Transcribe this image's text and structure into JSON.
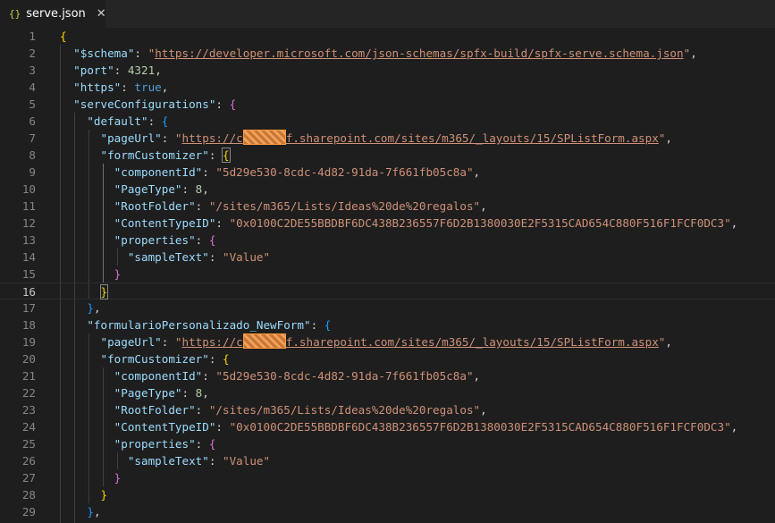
{
  "tab": {
    "icon": "{}",
    "name": "serve.json",
    "close": "✕"
  },
  "lines": [
    {
      "n": "1",
      "html": "<span class='br1'>{</span>"
    },
    {
      "n": "2",
      "html": "  <span class='k'>\"$schema\"</span><span class='p'>: </span><span class='s'>\"<span class='url'>https://developer.microsoft.com/json-schemas/spfx-build/spfx-serve.schema.json</span>\"</span><span class='p'>,</span>"
    },
    {
      "n": "3",
      "html": "  <span class='k'>\"port\"</span><span class='p'>: </span><span class='n'>4321</span><span class='p'>,</span>"
    },
    {
      "n": "4",
      "html": "  <span class='k'>\"https\"</span><span class='p'>: </span><span class='b'>true</span><span class='p'>,</span>"
    },
    {
      "n": "5",
      "html": "  <span class='k'>\"serveConfigurations\"</span><span class='p'>: </span><span class='br2'>{</span>"
    },
    {
      "n": "6",
      "html": "    <span class='k'>\"default\"</span><span class='p'>: </span><span class='br3'>{</span>"
    },
    {
      "n": "7",
      "html": "      <span class='k'>\"pageUrl\"</span><span class='p'>: </span><span class='s'>\"<span class='url'>https://c<span class='redact'></span>f.sharepoint.com/sites/m365/_layouts/15/SPListForm.aspx</span>\"</span><span class='p'>,</span>"
    },
    {
      "n": "8",
      "html": "      <span class='k'>\"formCustomizer\"</span><span class='p'>: </span><span class='br1 bracket-box'>{</span>"
    },
    {
      "n": "9",
      "html": "        <span class='k'>\"componentId\"</span><span class='p'>: </span><span class='s'>\"5d29e530-8cdc-4d82-91da-7f661fb05c8a\"</span><span class='p'>,</span>"
    },
    {
      "n": "10",
      "html": "        <span class='k'>\"PageType\"</span><span class='p'>: </span><span class='n'>8</span><span class='p'>,</span>"
    },
    {
      "n": "11",
      "html": "        <span class='k'>\"RootFolder\"</span><span class='p'>: </span><span class='s'>\"/sites/m365/Lists/Ideas%20de%20regalos\"</span><span class='p'>,</span>"
    },
    {
      "n": "12",
      "html": "        <span class='k'>\"ContentTypeID\"</span><span class='p'>: </span><span class='s'>\"0x0100C2DE55BBDBF6DC438B236557F6D2B1380030E2F5315CAD654C880F516F1FCF0DC3\"</span><span class='p'>,</span>"
    },
    {
      "n": "13",
      "html": "        <span class='k'>\"properties\"</span><span class='p'>: </span><span class='br2'>{</span>"
    },
    {
      "n": "14",
      "html": "          <span class='k'>\"sampleText\"</span><span class='p'>: </span><span class='s'>\"Value\"</span>"
    },
    {
      "n": "15",
      "html": "        <span class='br2'>}</span>"
    },
    {
      "n": "16",
      "html": "      <span class='br1 bracket-box'>}</span>",
      "current": true
    },
    {
      "n": "17",
      "html": "    <span class='br3'>}</span><span class='p'>,</span>"
    },
    {
      "n": "18",
      "html": "    <span class='k'>\"formularioPersonalizado_NewForm\"</span><span class='p'>: </span><span class='br3'>{</span>"
    },
    {
      "n": "19",
      "html": "      <span class='k'>\"pageUrl\"</span><span class='p'>: </span><span class='s'>\"<span class='url'>https://c<span class='redact'></span>f.sharepoint.com/sites/m365/_layouts/15/SPListForm.aspx</span>\"</span><span class='p'>,</span>"
    },
    {
      "n": "20",
      "html": "      <span class='k'>\"formCustomizer\"</span><span class='p'>: </span><span class='br1'>{</span>"
    },
    {
      "n": "21",
      "html": "        <span class='k'>\"componentId\"</span><span class='p'>: </span><span class='s'>\"5d29e530-8cdc-4d82-91da-7f661fb05c8a\"</span><span class='p'>,</span>"
    },
    {
      "n": "22",
      "html": "        <span class='k'>\"PageType\"</span><span class='p'>: </span><span class='n'>8</span><span class='p'>,</span>"
    },
    {
      "n": "23",
      "html": "        <span class='k'>\"RootFolder\"</span><span class='p'>: </span><span class='s'>\"/sites/m365/Lists/Ideas%20de%20regalos\"</span><span class='p'>,</span>"
    },
    {
      "n": "24",
      "html": "        <span class='k'>\"ContentTypeID\"</span><span class='p'>: </span><span class='s'>\"0x0100C2DE55BBDBF6DC438B236557F6D2B1380030E2F5315CAD654C880F516F1FCF0DC3\"</span><span class='p'>,</span>"
    },
    {
      "n": "25",
      "html": "        <span class='k'>\"properties\"</span><span class='p'>: </span><span class='br2'>{</span>"
    },
    {
      "n": "26",
      "html": "          <span class='k'>\"sampleText\"</span><span class='p'>: </span><span class='s'>\"Value\"</span>"
    },
    {
      "n": "27",
      "html": "        <span class='br2'>}</span>"
    },
    {
      "n": "28",
      "html": "      <span class='br1'>}</span>"
    },
    {
      "n": "29",
      "html": "    <span class='br3'>}</span><span class='p'>,</span>"
    }
  ]
}
